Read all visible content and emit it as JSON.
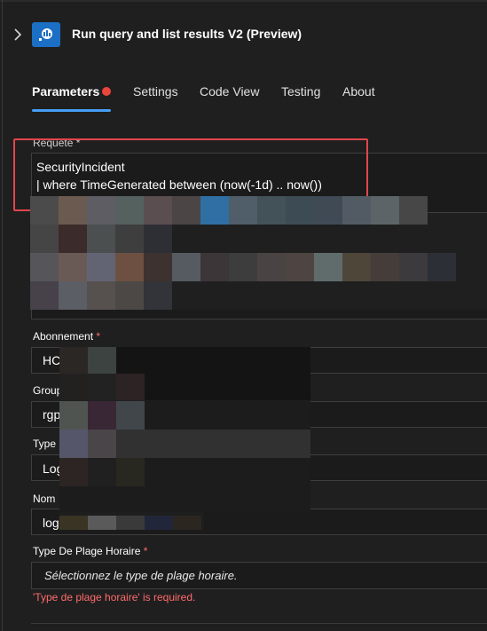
{
  "header": {
    "title": "Run query and list results V2 (Preview)",
    "expand_icon": "chevron-right-icon",
    "app_icon": "log-analytics-icon"
  },
  "tabs": [
    {
      "label": "Parameters",
      "active": true,
      "has_error": true
    },
    {
      "label": "Settings",
      "active": false
    },
    {
      "label": "Code View",
      "active": false
    },
    {
      "label": "Testing",
      "active": false
    },
    {
      "label": "About",
      "active": false
    }
  ],
  "query": {
    "label": "Requête *",
    "lines": [
      "SecurityIncident",
      "| where TimeGenerated between (now(-1d) .. now())"
    ]
  },
  "fields": {
    "abonnement": {
      "label": "Abonnement",
      "required": "*",
      "value": "HC"
    },
    "groupe": {
      "label": "Group",
      "value": "rgp"
    },
    "type": {
      "label": "Type I",
      "value": "Log"
    },
    "nom": {
      "label": "Nom",
      "value": "log"
    },
    "plage": {
      "label": "Type De Plage Horaire",
      "required": "*",
      "placeholder": "Sélectionnez le type de plage horaire.",
      "error": "'Type de plage horaire' is required."
    }
  },
  "colors": {
    "accent": "#479ef5",
    "error": "#ff6b6b",
    "highlight": "#e0464c",
    "background": "#1f1f1f"
  }
}
